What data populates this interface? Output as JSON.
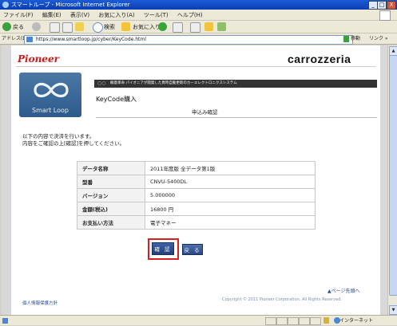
{
  "window": {
    "title": "スマートループ - Microsoft Internet Explorer",
    "controls": {
      "minimize": "_",
      "maximize": "□",
      "close": "X"
    }
  },
  "menubar": {
    "items": [
      "ファイル(F)",
      "編集(E)",
      "表示(V)",
      "お気に入り(A)",
      "ツール(T)",
      "ヘルプ(H)"
    ]
  },
  "toolbar": {
    "back_label": "戻る",
    "search_label": "検索",
    "favorites_label": "お気に入り"
  },
  "addressbar": {
    "label": "アドレス(D)",
    "url": "https://www.smartloop.jp/cyber/KeyCode.html",
    "go_label": "移動",
    "links_label": "リンク »"
  },
  "header": {
    "pioneer_logo": "Pioneer",
    "carrozzeria_logo": "carrozzeria",
    "smartloop_caption": "Smart Loop",
    "tagline_mark": "○○",
    "tagline": "概意革命 パイオニアが開発した異時自動更新のカーエレクトロニクスシステム"
  },
  "page": {
    "title": "KeyCode購入",
    "step": "申込み確認",
    "instructions": [
      "以下の内容で決済を行います。",
      "内容をご確認の上[確認]を押してください。"
    ]
  },
  "details": {
    "rows": [
      {
        "label": "データ名称",
        "value": "2011年度版 全データ第1版"
      },
      {
        "label": "型番",
        "value": "CNVU-5400DL"
      },
      {
        "label": "バージョン",
        "value": "5.000000"
      },
      {
        "label": "金額(税込)",
        "value": "16800 円"
      },
      {
        "label": "お支払い方法",
        "value": "電子マネー"
      }
    ]
  },
  "buttons": {
    "confirm": "確 認",
    "back": "戻 る"
  },
  "footer": {
    "page_top": "ページ先頭へ",
    "page_top_marker": "▲",
    "privacy": "個人情報保護方針",
    "copyright": "Copyright © 2011 Pioneer Corporation. All Rights Reserved."
  },
  "statusbar": {
    "zone": "インターネット"
  }
}
